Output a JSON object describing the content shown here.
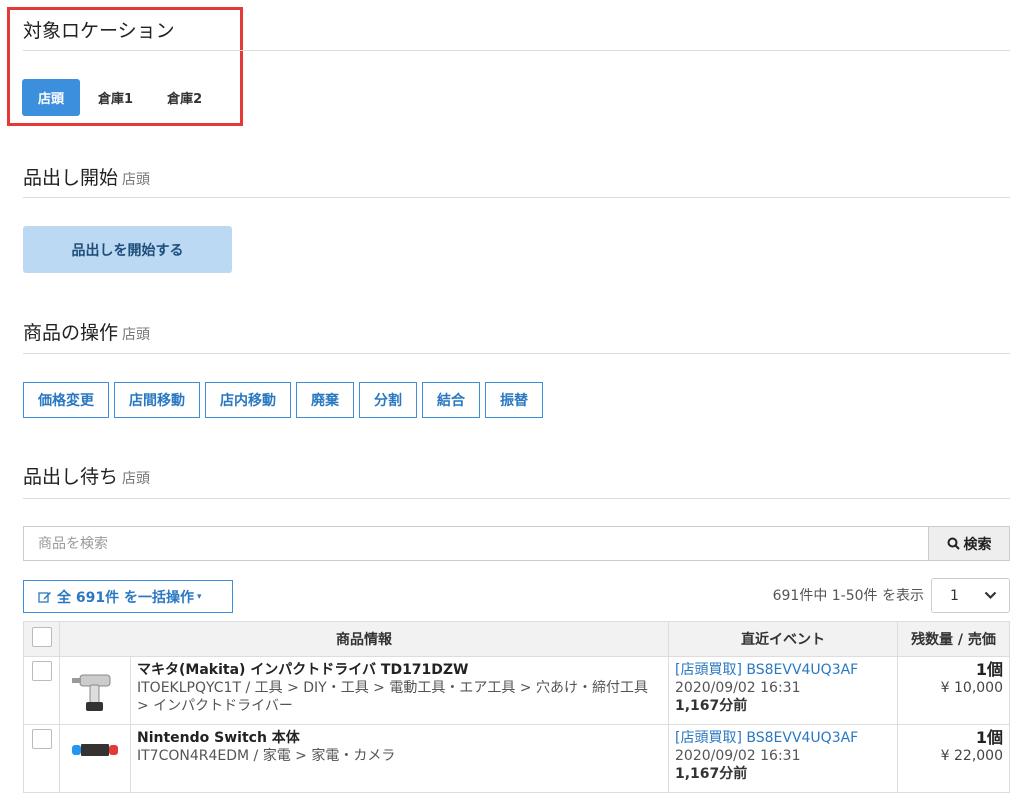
{
  "location": {
    "title": "対象ロケーション",
    "tabs": [
      "店頭",
      "倉庫1",
      "倉庫2"
    ]
  },
  "start": {
    "title": "品出し開始",
    "sub": "店頭",
    "button": "品出しを開始する"
  },
  "ops": {
    "title": "商品の操作",
    "sub": "店頭",
    "buttons": [
      "価格変更",
      "店間移動",
      "店内移動",
      "廃棄",
      "分割",
      "結合",
      "振替"
    ]
  },
  "waiting": {
    "title": "品出し待ち",
    "sub": "店頭"
  },
  "search": {
    "placeholder": "商品を検索",
    "button": "検索"
  },
  "bulk": {
    "label": "全 691件 を一括操作"
  },
  "paging": {
    "info": "691件中 1-50件 を表示",
    "page": "1"
  },
  "table": {
    "headers": [
      "商品情報",
      "直近イベント",
      "残数量 / 売価"
    ],
    "rows": [
      {
        "name": "マキタ(Makita) インパクトドライバ TD171DZW",
        "path": "ITOEKLPQYC1T / 工具 > DIY・工具 > 電動工具・エア工具 > 穴あけ・締付工具 > インパクトドライバー",
        "event": "[店頭買取] BS8EVV4UQ3AF",
        "date": "2020/09/02 16:31",
        "ago": "1,167分前",
        "qty": "1個",
        "price": "¥ 10,000"
      },
      {
        "name": "Nintendo Switch 本体",
        "path": "IT7CON4R4EDM / 家電 > 家電・カメラ",
        "event": "[店頭買取] BS8EVV4UQ3AF",
        "date": "2020/09/02 16:31",
        "ago": "1,167分前",
        "qty": "1個",
        "price": "¥ 22,000"
      }
    ]
  },
  "colors": {
    "accent": "#3b8fdc",
    "highlight": "#e53935"
  }
}
